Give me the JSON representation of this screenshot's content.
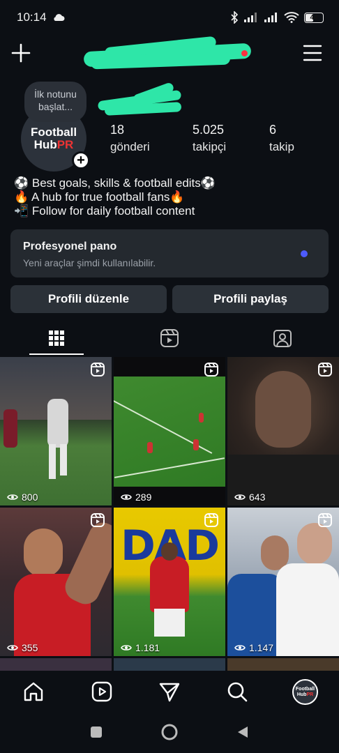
{
  "status_bar": {
    "time": "10:14",
    "battery": "44"
  },
  "profile": {
    "note_bubble": "İlk notunu başlat...",
    "avatar_text": {
      "line1": "Football",
      "line2a": "Hub",
      "line2b": "PR"
    },
    "stats": [
      {
        "value": "18",
        "label": "gönderi"
      },
      {
        "value": "5.025",
        "label": "takipçi"
      },
      {
        "value": "6",
        "label": "takip"
      }
    ],
    "bio": [
      "⚽ Best goals, skills & football edits⚽",
      "🔥 A hub for true football fans🔥",
      "📲 Follow for daily football content"
    ]
  },
  "pro_dashboard": {
    "title": "Profesyonel pano",
    "subtitle": "Yeni araçlar şimdi kullanılabilir."
  },
  "buttons": {
    "edit_profile": "Profili düzenle",
    "share_profile": "Profili paylaş"
  },
  "tabs": [
    "grid-icon",
    "reels-icon",
    "tagged-icon"
  ],
  "posts": [
    {
      "views": "800"
    },
    {
      "views": "289"
    },
    {
      "views": "643"
    },
    {
      "views": "355"
    },
    {
      "views": "1.181"
    },
    {
      "views": "1.147"
    }
  ],
  "colors": {
    "background": "#0c0f14",
    "card": "#24292f",
    "accent_dot": "#4d5bff",
    "notification": "#ff3040",
    "redaction": "#2ee6a8"
  },
  "bottom_nav": [
    "home-icon",
    "reels-icon",
    "direct-icon",
    "search-icon",
    "profile-avatar"
  ]
}
